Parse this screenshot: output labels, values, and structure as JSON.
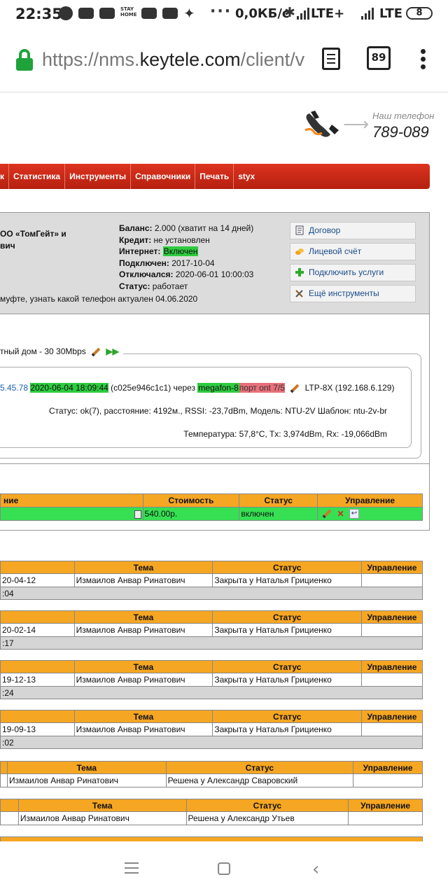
{
  "status_bar": {
    "time": "22:35",
    "stay_home_text": "STAY HOME",
    "net_speed": "0,0КБ/с",
    "lte1": "LTE+",
    "lte2": "LTE",
    "battery": "8"
  },
  "browser": {
    "url_prefix": "https://nms.",
    "url_host": "keytele.com",
    "url_path": "/client/v",
    "tab_count": "89"
  },
  "header": {
    "phone_label": "Наш телефон",
    "phone_number": "789-089"
  },
  "nav": {
    "items": [
      "к",
      "Статистика",
      "Инструменты",
      "Справочники",
      "Печать",
      "styx"
    ]
  },
  "client": {
    "name_line1": "ОО «ТомГейт» и",
    "name_line2": "вич",
    "balance_label": "Баланс:",
    "balance_value": "2.000 (хватит на 14 дней)",
    "credit_label": "Кредит:",
    "credit_value": "не установлен",
    "internet_label": "Интернет:",
    "internet_value": "Включен",
    "connected_label": "Подключен:",
    "connected_value": "2017-10-04",
    "disconnected_label": "Отключался:",
    "disconnected_value": "2020-06-01 10:00:03",
    "status_label": "Статус:",
    "status_value": "работает",
    "note": "муфте, узнать какой телефон актуален 04.06.2020",
    "buttons": [
      "Договор",
      "Лицевой счёт",
      "Подключить услуги",
      "Ещё инструменты"
    ]
  },
  "connection": {
    "legend": "тный дом - 30 30Mbps",
    "ip": "5.45.78",
    "datetime": "2020-06-04 18:09:44",
    "mac": "(c025e946c1c1) через",
    "olt": "megafon-8",
    "port": "порт ont 7/5",
    "ltp": "LTP-8X (192.168.6.129)",
    "status_line": "Статус: ok(7), расстояние: 4192м., RSSI: -23,7dBm, Модель: NTU-2V Шаблон: ntu-2v-br",
    "temp_line": "Температура: 57,8°C, Tx: 3,974dBm, Rx: -19,066dBm"
  },
  "services": {
    "headers": [
      "ние",
      "Стоимость",
      "Статус",
      "Управление"
    ],
    "row": {
      "price": "540.00р.",
      "status": "включен"
    }
  },
  "tickets_a": [
    {
      "headers": [
        "",
        "Тема",
        "Статус",
        "Управление"
      ],
      "date": "20-04-12",
      "author": "Измаилов Анвар Ринатович",
      "status": "Закрыта у Наталья Грициенко",
      "time": ":04"
    },
    {
      "headers": [
        "",
        "Тема",
        "Статус",
        "Управление"
      ],
      "date": "20-02-14",
      "author": "Измаилов Анвар Ринатович",
      "status": "Закрыта у Наталья Грициенко",
      "time": ":17"
    },
    {
      "headers": [
        "",
        "Тема",
        "Статус",
        "Управление"
      ],
      "date": "19-12-13",
      "author": "Измаилов Анвар Ринатович",
      "status": "Закрыта у Наталья Грициенко",
      "time": ":24"
    },
    {
      "headers": [
        "",
        "Тема",
        "Статус",
        "Управление"
      ],
      "date": "19-09-13",
      "author": "Измаилов Анвар Ринатович",
      "status": "Закрыта у Наталья Грициенко",
      "time": ":02"
    }
  ],
  "tickets_b": [
    {
      "headers": [
        "",
        "Тема",
        "Статус",
        "Управление"
      ],
      "author": "Измаилов Анвар Ринатович",
      "status": "Решена у Александр Сваровский"
    },
    {
      "headers": [
        "",
        "Тема",
        "Статус",
        "Управление"
      ],
      "author": "Измаилов Анвар Ринатович",
      "status": "Решена у Александр Утьев"
    }
  ],
  "colors": {
    "nav_red": "#cc2a17",
    "table_header_orange": "#f5a623",
    "active_green": "#36e052",
    "link_blue": "#1d5fb5"
  }
}
